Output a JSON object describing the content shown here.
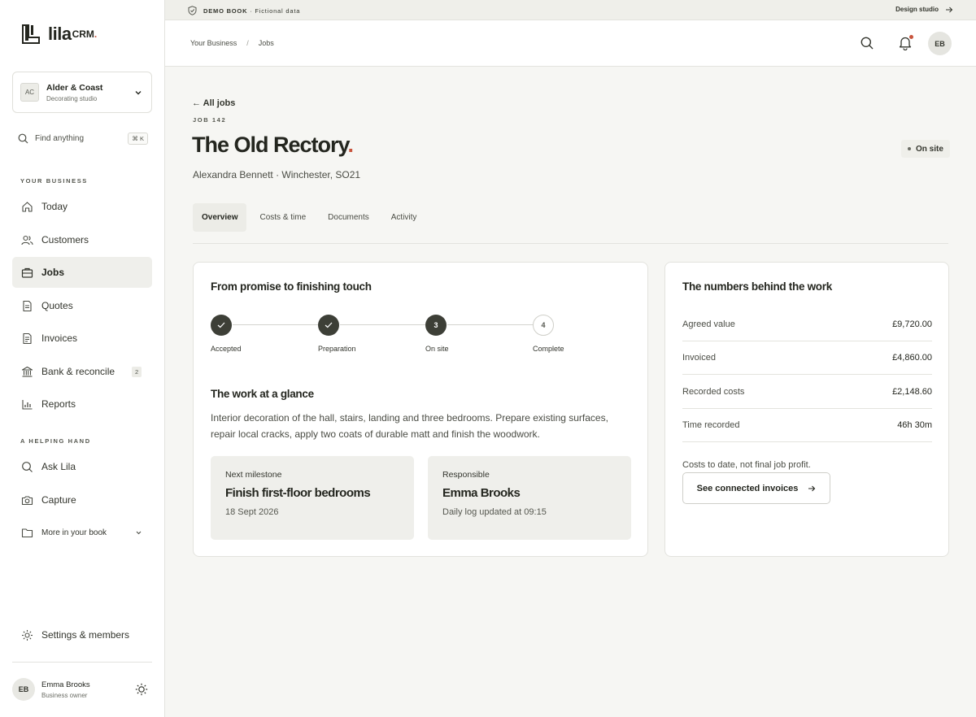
{
  "brand": {
    "name": "lila",
    "suffix": "CRM",
    "dot": "."
  },
  "org": {
    "initials": "AC",
    "name": "Alder & Coast",
    "type": "Decorating studio"
  },
  "find": {
    "label": "Find anything",
    "shortcut": "⌘ K"
  },
  "sidebar": {
    "section1": "YOUR BUSINESS",
    "items": [
      {
        "label": "Today",
        "icon": "home-icon"
      },
      {
        "label": "Customers",
        "icon": "users-icon"
      },
      {
        "label": "Jobs",
        "icon": "briefcase-icon",
        "active": true
      },
      {
        "label": "Quotes",
        "icon": "document-icon"
      },
      {
        "label": "Invoices",
        "icon": "invoice-icon"
      },
      {
        "label": "Bank & reconcile",
        "icon": "bank-icon",
        "count": "2"
      },
      {
        "label": "Reports",
        "icon": "chart-icon"
      }
    ],
    "section2": "A HELPING HAND",
    "help_items": [
      {
        "label": "Ask Lila",
        "icon": "search-icon"
      },
      {
        "label": "Capture",
        "icon": "camera-icon"
      },
      {
        "label": "More in your book",
        "icon": "folder-icon"
      }
    ],
    "settings": "Settings & members"
  },
  "user": {
    "initials": "EB",
    "name": "Emma Brooks",
    "role": "Business owner"
  },
  "banner": {
    "strong": "DEMO BOOK",
    "rest": " · Fictional data",
    "right": "Design studio"
  },
  "breadcrumb": {
    "first": "Your Business",
    "sep": "/",
    "current": "Jobs"
  },
  "header": {
    "avatar": "EB"
  },
  "job": {
    "back": "← All jobs",
    "number": "JOB 142",
    "title": "The Old Rectory",
    "title_dot": ".",
    "subtitle": "Alexandra Bennett · Winchester, SO21",
    "status": "On site"
  },
  "tabs": [
    "Overview",
    "Costs & time",
    "Documents",
    "Activity"
  ],
  "progress": {
    "heading": "From promise to finishing touch",
    "steps": [
      {
        "label": "Accepted",
        "state": "done"
      },
      {
        "label": "Preparation",
        "state": "done"
      },
      {
        "label": "On site",
        "state": "current",
        "number": "3"
      },
      {
        "label": "Complete",
        "state": "todo",
        "number": "4"
      }
    ]
  },
  "glance": {
    "heading": "The work at a glance",
    "description": "Interior decoration of the hall, stairs, landing and three bedrooms. Prepare existing surfaces, repair local cracks, apply two coats of durable matt and finish the woodwork."
  },
  "milestone": {
    "label": "Next milestone",
    "title": "Finish first-floor bedrooms",
    "date": "18 Sept 2026"
  },
  "responsible": {
    "label": "Responsible",
    "name": "Emma Brooks",
    "note": "Daily log updated at 09:15"
  },
  "numbers": {
    "heading": "The numbers behind the work",
    "rows": [
      {
        "label": "Agreed value",
        "value": "£9,720.00"
      },
      {
        "label": "Invoiced",
        "value": "£4,860.00"
      },
      {
        "label": "Recorded costs",
        "value": "£2,148.60"
      },
      {
        "label": "Time recorded",
        "value": "46h 30m"
      }
    ],
    "note": "Costs to date, not final job profit.",
    "button": "See connected invoices"
  }
}
